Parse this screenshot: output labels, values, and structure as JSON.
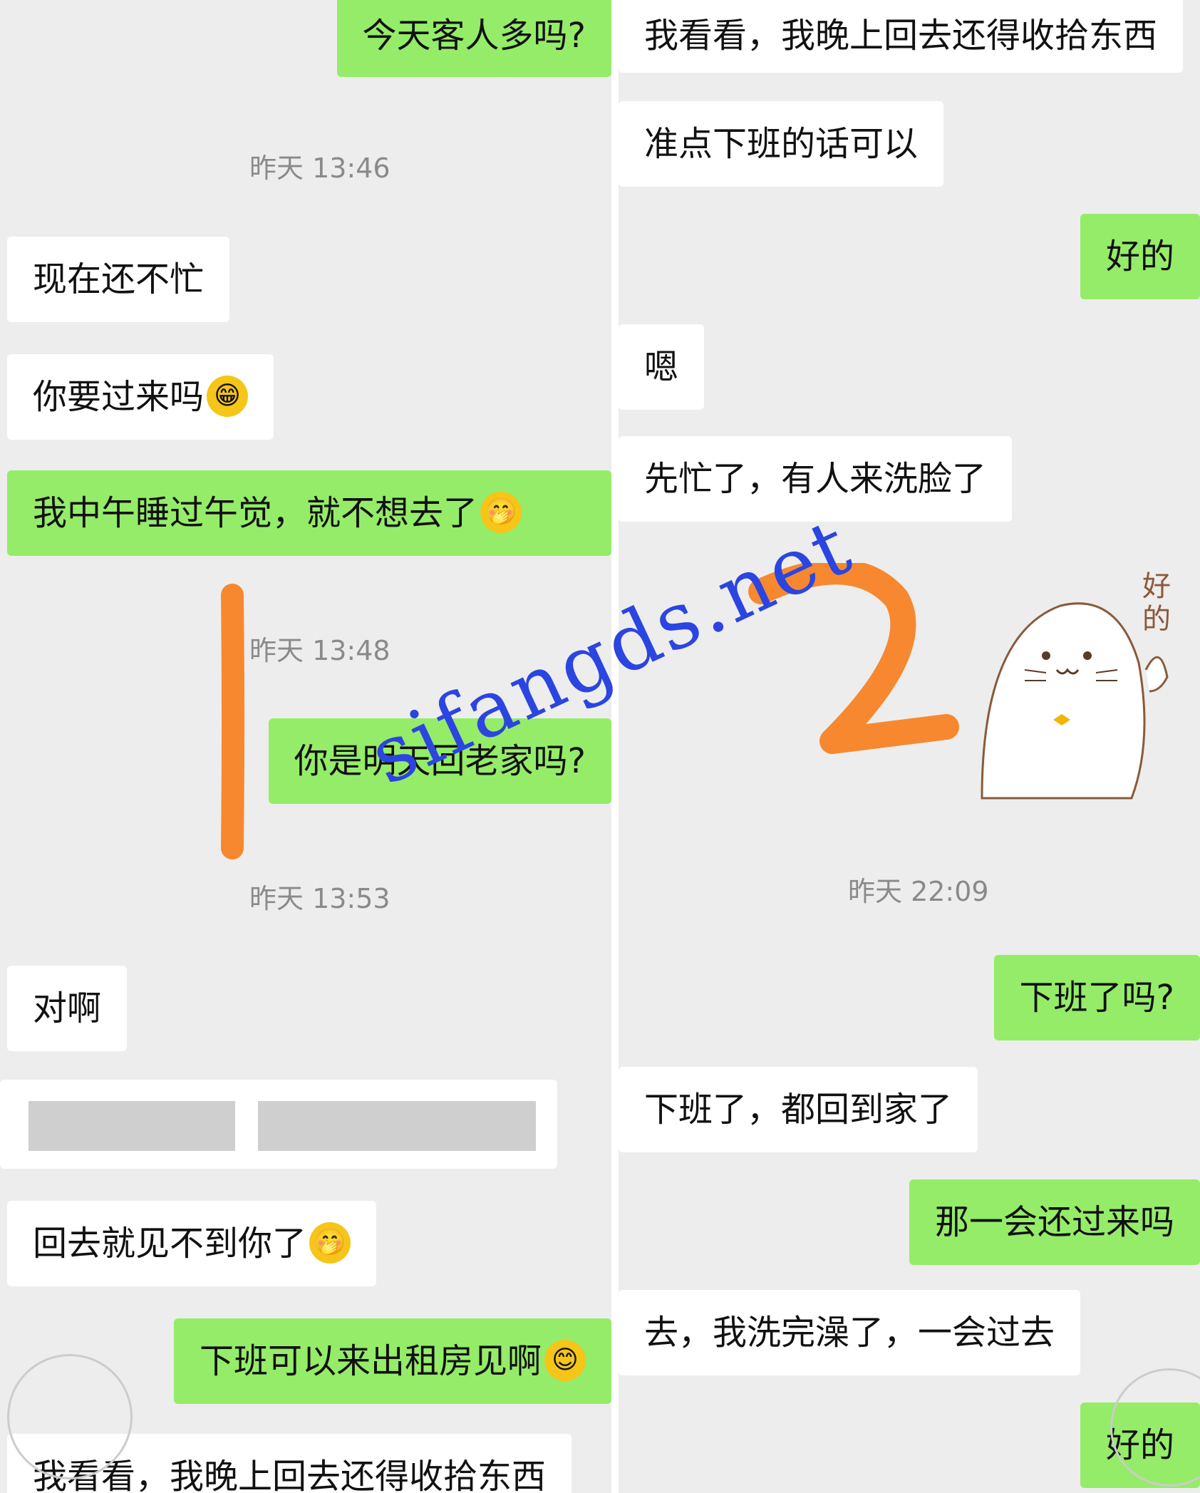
{
  "left": {
    "messages": [
      {
        "text": "今天客人多吗?",
        "dir": "out"
      },
      {
        "time": "昨天 13:46"
      },
      {
        "text": "现在还不忙",
        "dir": "in"
      },
      {
        "text": "你要过来吗",
        "dir": "in",
        "emoji": "😁"
      },
      {
        "text": "我中午睡过午觉，就不想去了",
        "dir": "out",
        "emoji": "🤭"
      },
      {
        "time": "昨天 13:48"
      },
      {
        "text": "你是明天回老家吗?",
        "dir": "out"
      },
      {
        "time": "昨天 13:53"
      },
      {
        "text": "对啊",
        "dir": "in"
      },
      {
        "text": "回去就见不到你了",
        "dir": "in",
        "emoji": "🤭"
      },
      {
        "text": "下班可以来出租房见啊",
        "dir": "out",
        "emoji": "😊"
      },
      {
        "text": "我看看，我晚上回去还得收拾东西",
        "dir": "in"
      }
    ],
    "annotation": "1"
  },
  "right": {
    "messages": [
      {
        "text": "我看看，我晚上回去还得收拾东西",
        "dir": "in"
      },
      {
        "text": "准点下班的话可以",
        "dir": "in"
      },
      {
        "text": "好的",
        "dir": "out"
      },
      {
        "text": "嗯",
        "dir": "in"
      },
      {
        "text": "先忙了，有人来洗脸了",
        "dir": "in"
      },
      {
        "sticker_text": "好的"
      },
      {
        "time": "昨天 22:09"
      },
      {
        "text": "下班了吗?",
        "dir": "out"
      },
      {
        "text": "下班了，都回到家了",
        "dir": "in"
      },
      {
        "text": "那一会还过来吗",
        "dir": "out"
      },
      {
        "text": "去，我洗完澡了，一会过去",
        "dir": "in"
      },
      {
        "text": "好的",
        "dir": "out"
      }
    ],
    "annotation": "2"
  },
  "watermark": "sifangds.net",
  "colors": {
    "incoming": "#ffffff",
    "outgoing": "#95ec69",
    "background": "#ededed",
    "annotation": "#f7882f",
    "watermark": "#2b45e0"
  }
}
